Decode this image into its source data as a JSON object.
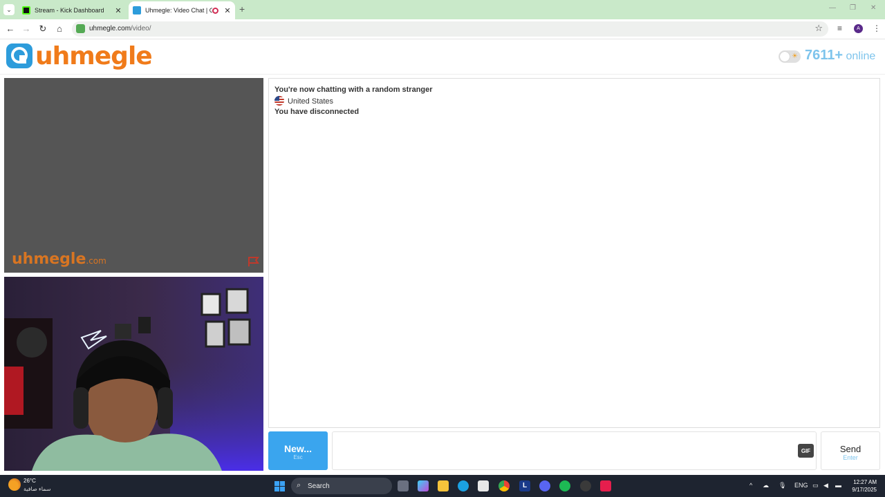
{
  "browser": {
    "tabs": [
      {
        "title": "Stream - Kick Dashboard",
        "active": false,
        "favicon_color": "#53fc18"
      },
      {
        "title": "Uhmegle: Video Chat | Ome",
        "active": true,
        "favicon_color": "#2d9cdb"
      }
    ],
    "url_domain": "uhmegle.com",
    "url_path": "/video/",
    "profile_initial": "A"
  },
  "site": {
    "logo_text": "uhmegle",
    "online_count": "7611+",
    "online_label": "online"
  },
  "video": {
    "watermark": "uhmegle",
    "watermark_domain": ".com"
  },
  "chat": {
    "messages": [
      {
        "text": "You're now chatting with a random stranger",
        "bold": true
      },
      {
        "text": "United States",
        "bold": false,
        "flag": "us-flag"
      },
      {
        "text": "You have disconnected",
        "bold": true
      }
    ]
  },
  "controls": {
    "new_label": "New...",
    "new_hint": "Esc",
    "gif_label": "GIF",
    "send_label": "Send",
    "send_hint": "Enter",
    "message_placeholder": ""
  },
  "taskbar": {
    "temperature": "26°C",
    "weather_desc": "سماء صافية",
    "search_label": "Search",
    "language": "ENG",
    "time": "12:27 AM",
    "date": "9/17/2025"
  },
  "colors": {
    "brand_orange": "#f07b1a",
    "brand_blue": "#2d9cdb",
    "new_button": "#3aa5ee",
    "online_text": "#7ec4ec"
  }
}
